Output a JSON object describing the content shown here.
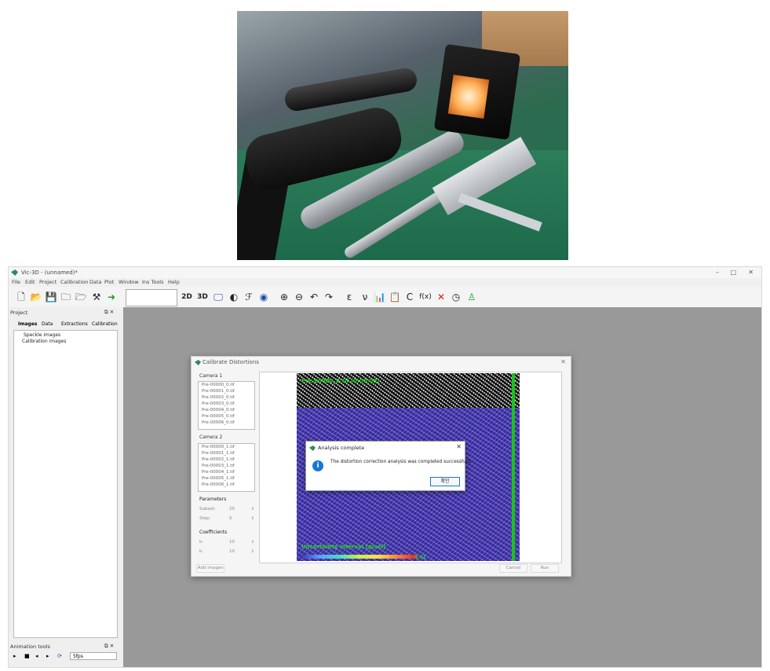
{
  "window": {
    "title": "Vic-3D - (unnamed)*",
    "controls": [
      "–",
      "□",
      "✕"
    ]
  },
  "menu": [
    "File",
    "Edit",
    "Project",
    "Calibration",
    "Data",
    "Plot",
    "Window",
    "Ins Tools",
    "Help"
  ],
  "toolbar": {
    "labels": {
      "two_d": "2D",
      "three_d": "3D",
      "epsilon": "ε",
      "nu": "ν",
      "c": "C",
      "fx": "f(x)"
    }
  },
  "project_panel": {
    "title": "Project",
    "tabs": [
      "Images",
      "Data",
      "Extractions",
      "Calibration"
    ],
    "tree": [
      "Speckle images",
      "Calibration images"
    ]
  },
  "animation_panel": {
    "title": "Animation tools",
    "fps": "5fps"
  },
  "dialog": {
    "title": "Calibrate Distortions",
    "camera1_label": "Camera 1",
    "camera1_files": [
      "Pre-00000_0.tif",
      "Pre-00001_0.tif",
      "Pre-00002_0.tif",
      "Pre-00003_0.tif",
      "Pre-00004_0.tif",
      "Pre-00005_0.tif",
      "Pre-00006_0.tif"
    ],
    "camera2_label": "Camera 2",
    "camera2_files": [
      "Pre-00000_1.tif",
      "Pre-00001_1.tif",
      "Pre-00002_1.tif",
      "Pre-00003_1.tif",
      "Pre-00004_1.tif",
      "Pre-00005_1.tif",
      "Pre-00006_1.tif"
    ],
    "parameters_label": "Parameters",
    "subset_label": "Subset:",
    "subset_value": "25",
    "step_label": "Step:",
    "step_value": "5",
    "coefficients_label": "Coefficients",
    "k1_label": "k:",
    "k1_value": "10",
    "k2_label": "k:",
    "k2_value": "10",
    "add_images": "Add images",
    "cancel": "Cancel",
    "run": "Run",
    "image_top_text": "Pre-00000_0.tif [0:00:00]",
    "image_bottom_text": "Uncertainty interval [pixel]",
    "colorbar_value": "0.01"
  },
  "message": {
    "title": "Analysis complete",
    "text": "The distortion correction analysis was completed successfully.",
    "ok": "확인"
  }
}
